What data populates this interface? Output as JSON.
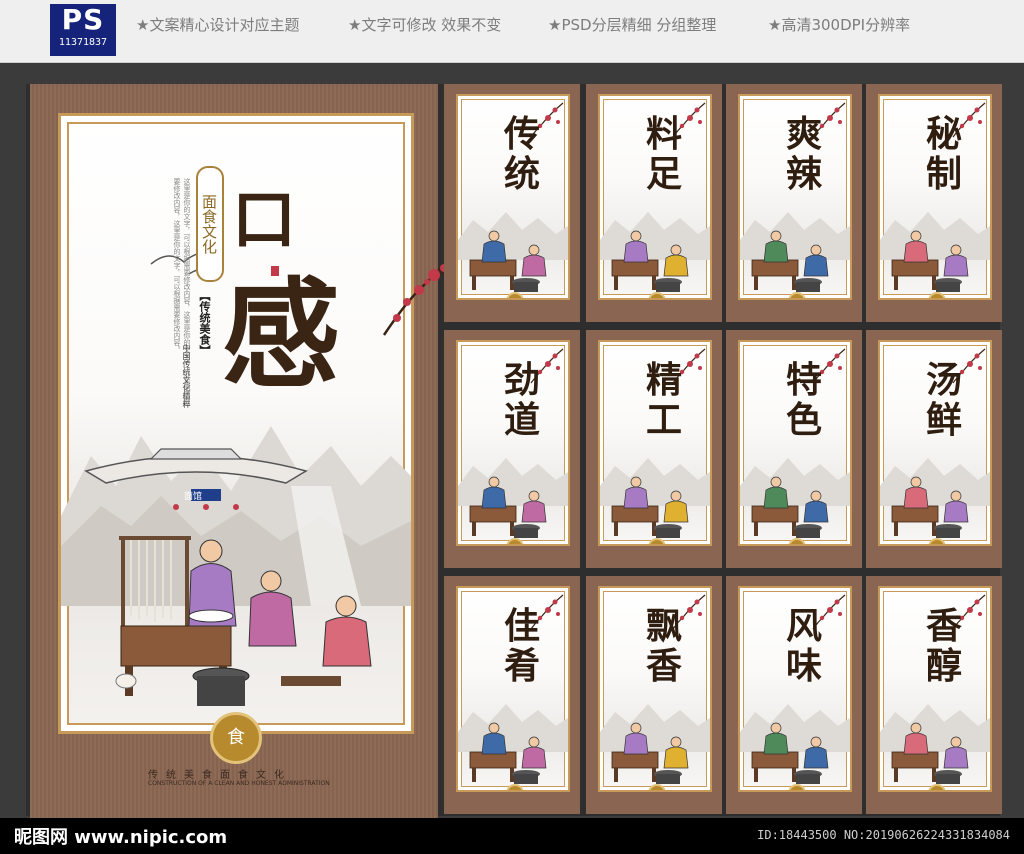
{
  "header": {
    "ps_label": "PS",
    "ps_id": "11371837",
    "features": [
      "★文案精心设计对应主题",
      "★文字可修改 效果不变",
      "★PSD分层精细 分组整理",
      "★高清300DPI分辨率"
    ]
  },
  "main_poster": {
    "title_top": "口",
    "title_bottom": "感",
    "seal_text": "面食文化",
    "label": "【传统美食】",
    "subtitle": "中国传统文化精粹",
    "body_text": "这里是你的文字，可以根据需要修改内容，这里是你的文字，可以根据需要修改内容，这里是你的文字，可以根据需要修改内容。",
    "shop_sign": "面馆",
    "bottom_seal": "食",
    "caption_cn": "传统美食面食文化",
    "caption_en": "CONSTRUCTION OF A CLEAN AND HONEST ADMINISTRATION"
  },
  "posters": [
    {
      "t1": "传",
      "t2": "统"
    },
    {
      "t1": "料",
      "t2": "足"
    },
    {
      "t1": "爽",
      "t2": "辣"
    },
    {
      "t1": "秘",
      "t2": "制"
    },
    {
      "t1": "劲",
      "t2": "道"
    },
    {
      "t1": "精",
      "t2": "工"
    },
    {
      "t1": "特",
      "t2": "色"
    },
    {
      "t1": "汤",
      "t2": "鲜"
    },
    {
      "t1": "佳",
      "t2": "肴"
    },
    {
      "t1": "飘",
      "t2": "香"
    },
    {
      "t1": "风",
      "t2": "味"
    },
    {
      "t1": "香",
      "t2": "醇"
    }
  ],
  "footer": {
    "site": "昵图网 www.nipic.com",
    "id": "ID:18443500 NO:20190626224331834084"
  },
  "colors": {
    "poster_brown": "#8a6652",
    "frame_gold": "#c79a5a",
    "ink": "#2f1d10",
    "plum_red": "#c23a4a"
  }
}
